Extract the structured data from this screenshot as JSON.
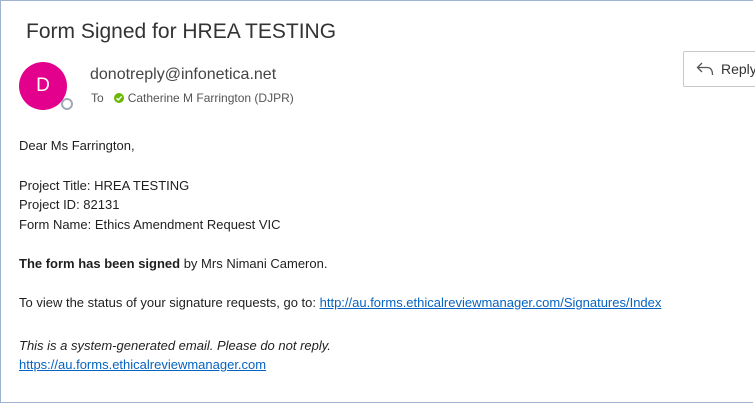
{
  "email": {
    "subject": "Form Signed for HREA TESTING",
    "avatar_initial": "D",
    "avatar_color": "#e3008c",
    "sender": "donotreply@infonetica.net",
    "to_label": "To",
    "recipient": "Catherine M Farrington (DJPR)",
    "recipient_status_color": "#6bb700",
    "reply_label": "Reply",
    "reply_icon": "reply-arrow-icon"
  },
  "body": {
    "greeting": "Dear Ms Farrington,",
    "project_title": "Project Title: HREA TESTING",
    "project_id": "Project ID: 82131",
    "form_name": "Form Name: Ethics Amendment Request VIC",
    "signed_bold": "The form has been signed",
    "signed_rest": " by Mrs Nimani Cameron.",
    "status_prefix": "To view the status of your signature requests, go to: ",
    "status_link": "http://au.forms.ethicalreviewmanager.com/Signatures/Index",
    "footer_note": "This is a system-generated email. Please do not reply.",
    "footer_link": "https://au.forms.ethicalreviewmanager.com"
  }
}
